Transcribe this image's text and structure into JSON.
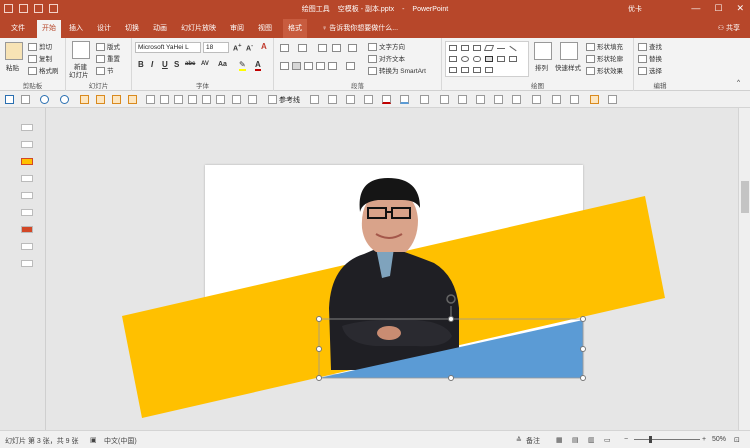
{
  "window": {
    "title_tool": "绘图工具",
    "title_file": "空模板 - 副本.pptx",
    "title_sep": "-",
    "title_app": "PowerPoint",
    "user": "优卡",
    "min": "—",
    "max": "☐",
    "close": "✕"
  },
  "tabs": [
    "文件",
    "开始",
    "插入",
    "设计",
    "切换",
    "动画",
    "幻灯片放映",
    "审阅",
    "视图",
    "格式"
  ],
  "tell_me": "告诉我你想要做什么...",
  "share": "共享",
  "ribbon": {
    "clipboard": {
      "paste": "粘贴",
      "cut": "剪切",
      "copy": "复制",
      "format_painter": "格式刷",
      "label": "剪贴板"
    },
    "slides": {
      "new_slide": "新建",
      "new_slide2": "幻灯片",
      "layout": "版式",
      "reset": "重置",
      "section": "节",
      "label": "幻灯片"
    },
    "font": {
      "font_name": "Microsoft YaHei L",
      "font_size": "18",
      "bold": "B",
      "italic": "I",
      "underline": "U",
      "strike": "S",
      "shadow": "abc",
      "spacing": "AV",
      "case": "Aa",
      "label": "字体"
    },
    "paragraph": {
      "text_direction": "文字方向",
      "align_text": "对齐文本",
      "smartart": "转换为 SmartArt",
      "label": "段落"
    },
    "drawing": {
      "arrange": "排列",
      "quick_styles": "快速样式",
      "shape_fill": "形状填充",
      "shape_outline": "形状轮廓",
      "shape_effects": "形状效果",
      "label": "绘图"
    },
    "editing": {
      "find": "查找",
      "replace": "替换",
      "select": "选择",
      "label": "编辑"
    }
  },
  "quick_bar": {
    "gridlines_label": "参考线"
  },
  "slide_visual": {
    "yellow": "#FFC000",
    "blue": "#5B9BD5",
    "accent": "#b7472a"
  },
  "status": {
    "slide_info": "幻灯片 第 3 张，共 9 张",
    "language": "中文(中国)",
    "notes": "备注",
    "zoom": "50%"
  }
}
